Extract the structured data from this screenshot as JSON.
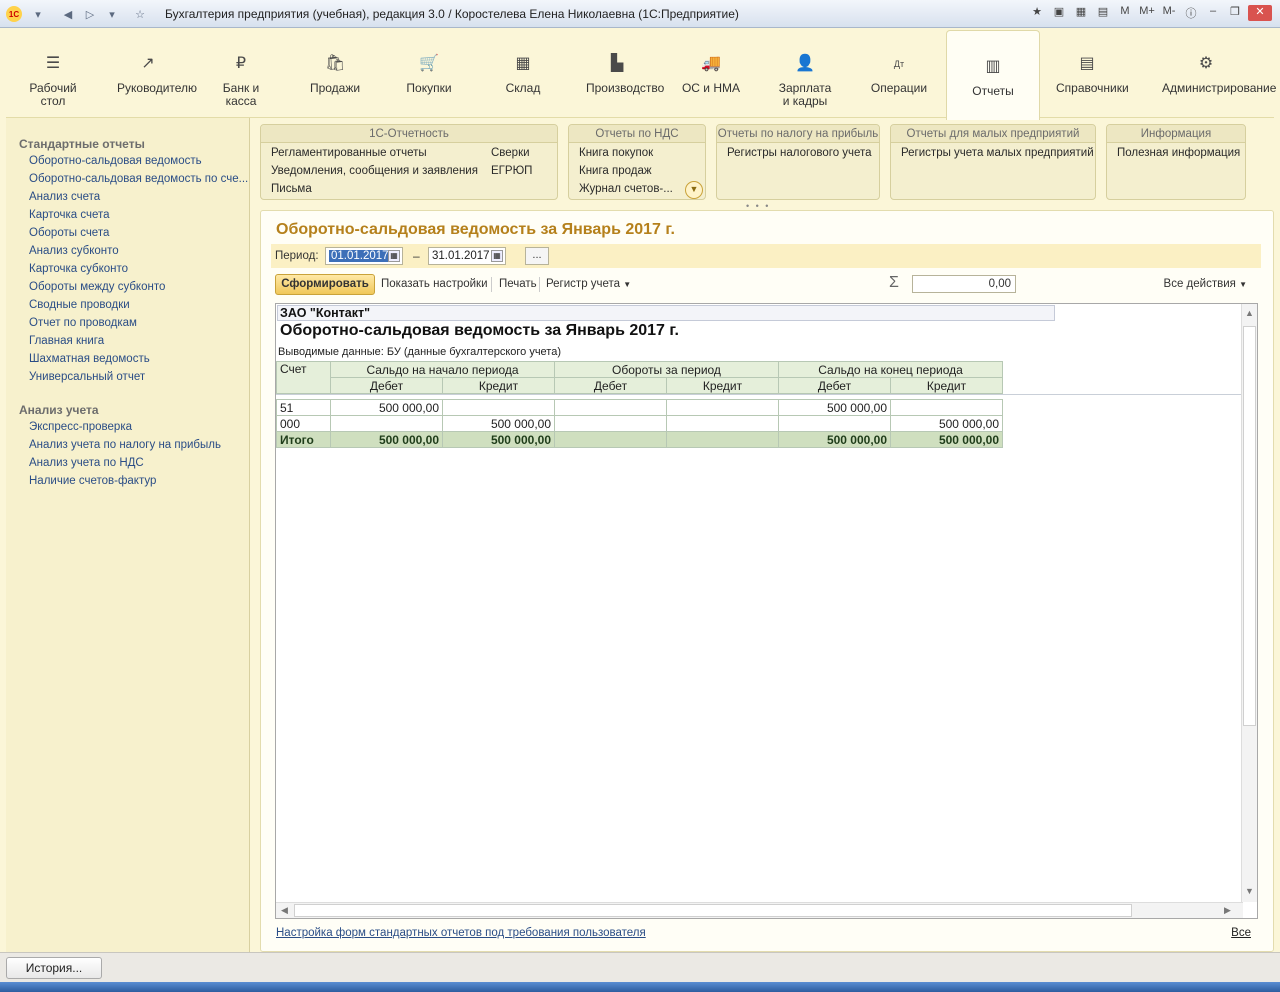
{
  "window": {
    "title": "Бухгалтерия предприятия (учебная), редакция 3.0 / Коростелева Елена Николаевна  (1С:Предприятие)",
    "logo_text": "1С",
    "memory_buttons": [
      "M",
      "M+",
      "M-"
    ]
  },
  "sections": [
    {
      "label": "Рабочий стол",
      "icon": "menu-icon",
      "glyph": "☰"
    },
    {
      "label": "Руководителю",
      "icon": "trend-icon",
      "glyph": "↗"
    },
    {
      "label": "Банк и касса",
      "icon": "ruble-icon",
      "glyph": "₽"
    },
    {
      "label": "Продажи",
      "icon": "bag-icon",
      "glyph": "🛍"
    },
    {
      "label": "Покупки",
      "icon": "cart-icon",
      "glyph": "🛒"
    },
    {
      "label": "Склад",
      "icon": "grid-icon",
      "glyph": "▦"
    },
    {
      "label": "Производство",
      "icon": "factory-icon",
      "glyph": "▙"
    },
    {
      "label": "ОС и НМА",
      "icon": "truck-icon",
      "glyph": "🚚"
    },
    {
      "label": "Зарплата и кадры",
      "icon": "person-icon",
      "glyph": "👤"
    },
    {
      "label": "Операции",
      "icon": "dt-kt-icon",
      "glyph": "Дт"
    },
    {
      "label": "Отчеты",
      "icon": "bar-chart-icon",
      "glyph": "▥"
    },
    {
      "label": "Справочники",
      "icon": "books-icon",
      "glyph": "▤"
    },
    {
      "label": "Администрирование",
      "icon": "gear-icon",
      "glyph": "⚙"
    }
  ],
  "left_panel": {
    "standard_title": "Стандартные отчеты",
    "standard_items": [
      "Оборотно-сальдовая ведомость",
      "Оборотно-сальдовая ведомость по сче...",
      "Анализ счета",
      "Карточка счета",
      "Обороты счета",
      "Анализ субконто",
      "Карточка субконто",
      "Обороты между субконто",
      "Сводные проводки",
      "Отчет по проводкам",
      "Главная книга",
      "Шахматная ведомость",
      "Универсальный отчет"
    ],
    "analysis_title": "Анализ учета",
    "analysis_items": [
      "Экспресс-проверка",
      "Анализ учета по налогу на прибыль",
      "Анализ учета по НДС",
      "Наличие счетов-фактур"
    ]
  },
  "groups": [
    {
      "title": "1С-Отчетность",
      "items": [
        "Регламентированные отчеты",
        "Уведомления, сообщения и заявления",
        "Письма",
        "Сверки",
        "ЕГРЮП"
      ]
    },
    {
      "title": "Отчеты по НДС",
      "items": [
        "Книга покупок",
        "Книга продаж",
        "Журнал счетов-..."
      ]
    },
    {
      "title": "Отчеты по налогу на прибыль",
      "items": [
        "Регистры налогового учета"
      ]
    },
    {
      "title": "Отчеты для малых предприятий",
      "items": [
        "Регистры учета малых предприятий"
      ]
    },
    {
      "title": "Информация",
      "items": [
        "Полезная информация"
      ]
    }
  ],
  "report": {
    "title": "Оборотно-сальдовая ведомость за Январь 2017 г.",
    "period_label": "Период:",
    "date_from": "01.01.2017",
    "date_to": "31.01.2017",
    "dash": "–",
    "more_button": "...",
    "generate_button": "Сформировать",
    "show_settings": "Показать настройки",
    "print": "Печать",
    "register": "Регистр учета",
    "sum_value": "0,00",
    "all_actions": "Все действия",
    "footer_link": "Настройка форм стандартных отчетов под требования пользователя",
    "all_link": "Все"
  },
  "sheet": {
    "company": "ЗАО \"Контакт\"",
    "title": "Оборотно-сальдовая ведомость за Январь 2017 г.",
    "output_data": "Выводимые данные:  БУ (данные бухгалтерского учета)",
    "col_account": "Счет",
    "col_groups": [
      "Сальдо на начало периода",
      "Обороты за период",
      "Сальдо на конец периода"
    ],
    "col_debit": "Дебет",
    "col_credit": "Кредит",
    "rows": [
      {
        "account": "51",
        "sd": "500 000,00",
        "sk": "",
        "od": "",
        "ok": "",
        "ed": "500 000,00",
        "ek": ""
      },
      {
        "account": "000",
        "sd": "",
        "sk": "500 000,00",
        "od": "",
        "ok": "",
        "ed": "",
        "ek": "500 000,00"
      }
    ],
    "total": {
      "account": "Итого",
      "sd": "500 000,00",
      "sk": "500 000,00",
      "od": "",
      "ok": "",
      "ed": "500 000,00",
      "ek": "500 000,00"
    }
  },
  "bottom": {
    "history_button": "История..."
  }
}
